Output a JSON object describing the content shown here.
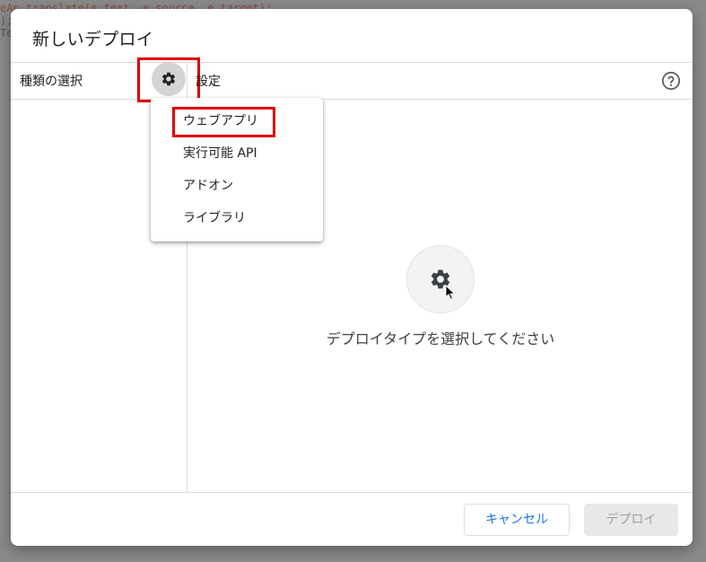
{
  "background_code": {
    "line1": "eAp.translate(e.text, e.source, e.target);",
    "line2": ");",
    "line3": "Te"
  },
  "dialog": {
    "title": "新しいデプロイ",
    "left_panel_header": "種類の選択",
    "right_panel_header": "設定",
    "gear_icon": "gear-icon",
    "help_icon": "help-circle-icon",
    "empty_state_text": "デプロイタイプを選択してください"
  },
  "type_menu": {
    "items": [
      "ウェブアプリ",
      "実行可能 API",
      "アドオン",
      "ライブラリ"
    ]
  },
  "footer": {
    "cancel_label": "キャンセル",
    "deploy_label": "デプロイ"
  },
  "colors": {
    "accent_blue": "#1a73e8",
    "highlight_red": "#e00000",
    "disabled_bg": "#e8e8e8"
  }
}
